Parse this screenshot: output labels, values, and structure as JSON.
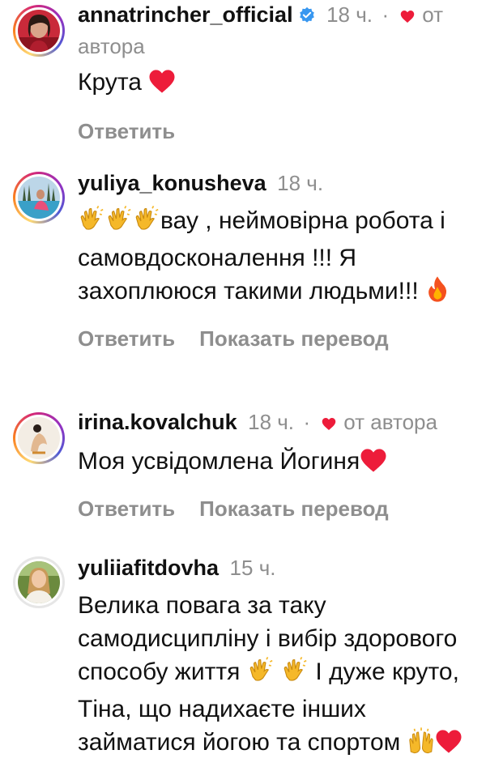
{
  "colors": {
    "meta_gray": "#8e8e8e",
    "text": "#111111",
    "heart_red": "#ed1c3a",
    "verified_blue": "#3897f0"
  },
  "comments": [
    {
      "username": "annatrincher_official",
      "verified": true,
      "time": "18 ч.",
      "separator": "·",
      "liked_by_author": true,
      "author_like_label": "от автора",
      "text": "Крута",
      "trailing_emojis": [
        "red-heart"
      ],
      "actions": [
        "Ответить"
      ]
    },
    {
      "username": "yuliya_konusheva",
      "verified": false,
      "time": "18 ч.",
      "leading_emojis": [
        "clapping-hands",
        "clapping-hands",
        "clapping-hands"
      ],
      "text": "вау , неймовірна робота і самовдосконалення !!! Я захоплююся такими людьми!!!",
      "trailing_emojis": [
        "fire"
      ],
      "actions": [
        "Ответить",
        "Показать перевод"
      ]
    },
    {
      "username": "irina.kovalchuk",
      "verified": false,
      "time": "18 ч.",
      "separator": "·",
      "liked_by_author": true,
      "author_like_label": "от автора",
      "text": "Моя усвідомлена Йогиня",
      "trailing_emojis": [
        "red-heart"
      ],
      "actions": [
        "Ответить",
        "Показать перевод"
      ]
    },
    {
      "username": "yuliiafitdovha",
      "verified": false,
      "time": "15 ч.",
      "text_part1": "Велика повага за таку самодисципліну і вибір здорового способу життя",
      "text_part2": "І дуже круто, Тіна, що надихаєте інших займатися йогою та спортом",
      "mid_emojis": [
        "clapping-hands",
        "clapping-hands"
      ],
      "trailing_emojis": [
        "raising-hands",
        "red-heart"
      ]
    }
  ]
}
